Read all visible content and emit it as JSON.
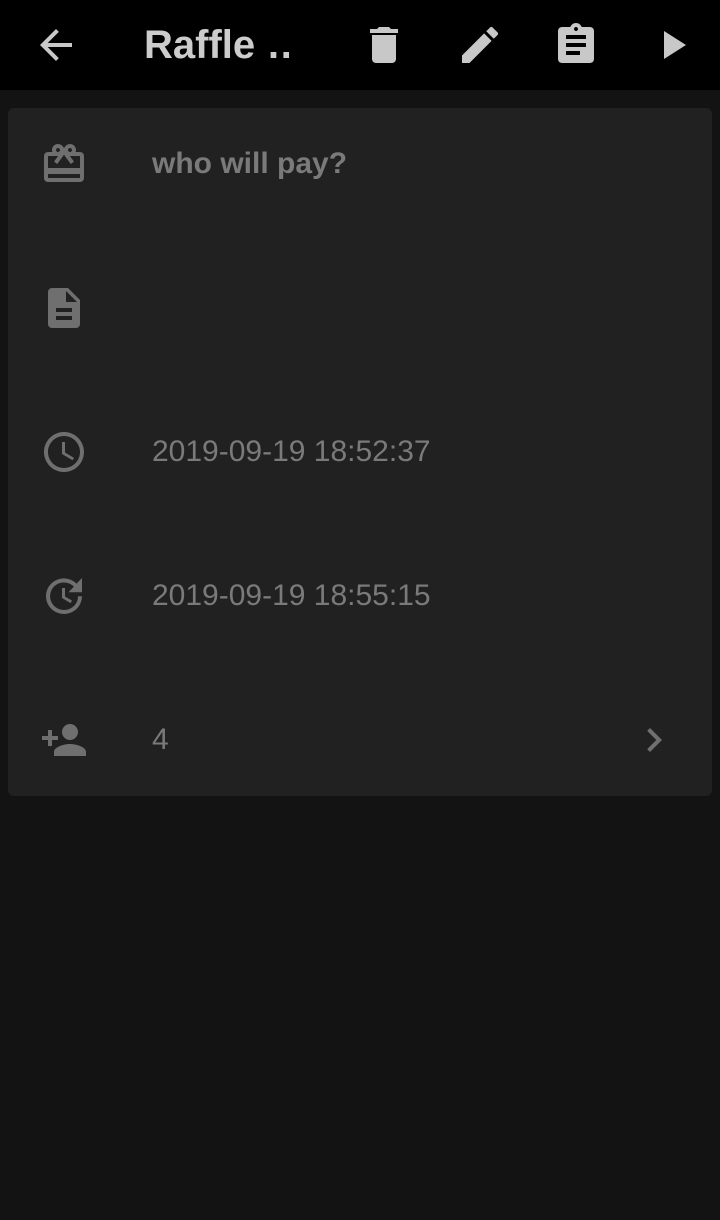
{
  "toolbar": {
    "title": "Raffle …",
    "back_icon": "arrow-back-icon",
    "actions": [
      {
        "name": "delete",
        "icon": "trash-icon"
      },
      {
        "name": "edit",
        "icon": "pencil-icon"
      },
      {
        "name": "clipboard",
        "icon": "clipboard-icon"
      },
      {
        "name": "play",
        "icon": "play-icon"
      }
    ]
  },
  "details": {
    "raffle_name": "who will pay?",
    "description": "",
    "created": "2019-09-19 18:52:37",
    "updated": "2019-09-19 18:55:15",
    "participants_count": "4"
  },
  "colors": {
    "appbar_bg": "#000000",
    "page_bg": "#131313",
    "card_bg": "#212121",
    "icon_gray": "#6f6f6f",
    "text_gray": "#7a7a7a"
  }
}
